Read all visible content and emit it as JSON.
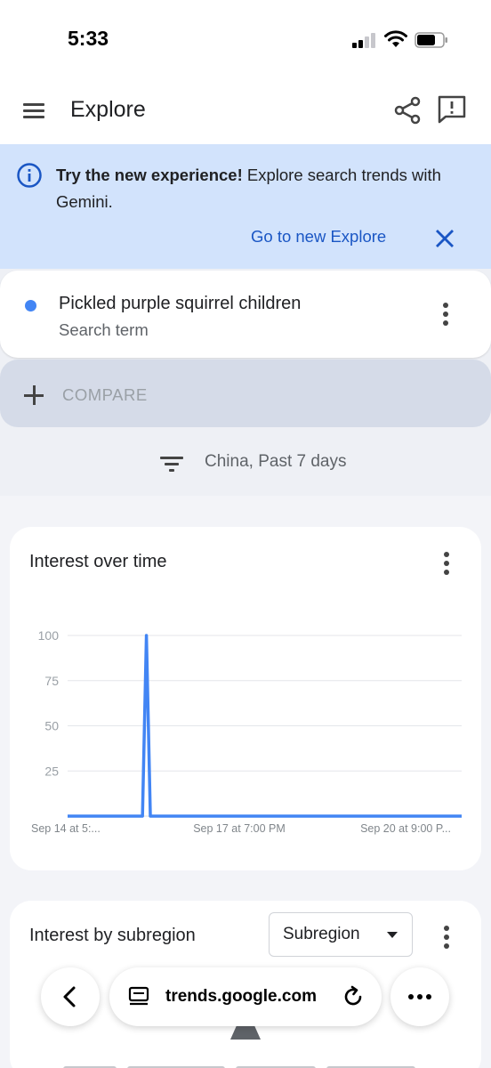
{
  "status_bar": {
    "time": "5:33"
  },
  "app_bar": {
    "title": "Explore"
  },
  "banner": {
    "bold_text": "Try the new experience!",
    "text": " Explore search trends with Gemini.",
    "link_label": "Go to new Explore"
  },
  "search_term": {
    "name": "Pickled purple squirrel children",
    "subtitle": "Search term",
    "color": "#4285f4"
  },
  "compare": {
    "label": "COMPARE"
  },
  "filter": {
    "text": "China, Past 7 days"
  },
  "interest_over_time": {
    "title": "Interest over time"
  },
  "chart_data": {
    "type": "line",
    "title": "Interest over time",
    "xlabel": "",
    "ylabel": "",
    "ylim": [
      0,
      100
    ],
    "yticks": [
      25,
      50,
      75,
      100
    ],
    "xtick_labels": [
      "Sep 14 at 5:...",
      "Sep 17 at 7:00 PM",
      "Sep 20 at 9:00 P..."
    ],
    "grid": true,
    "series": [
      {
        "color": "#4285f4",
        "x": [
          0,
          0.19,
          0.2,
          0.21,
          0.22,
          1
        ],
        "values": [
          0,
          0,
          100,
          0,
          0,
          0
        ]
      }
    ]
  },
  "interest_by_subregion": {
    "title": "Interest by subregion",
    "dropdown_value": "Subregion"
  },
  "browser": {
    "url": "trends.google.com"
  },
  "icons": {
    "menu": "hamburger-menu-icon",
    "share": "share-icon",
    "feedback": "feedback-icon",
    "info": "info-icon",
    "close": "close-icon",
    "more": "more-vert-icon",
    "plus": "plus-icon",
    "filter": "filter-icon",
    "back": "chevron-left-icon",
    "tabs": "tabs-icon",
    "reload": "reload-icon",
    "more_horiz": "more-horiz-icon"
  }
}
